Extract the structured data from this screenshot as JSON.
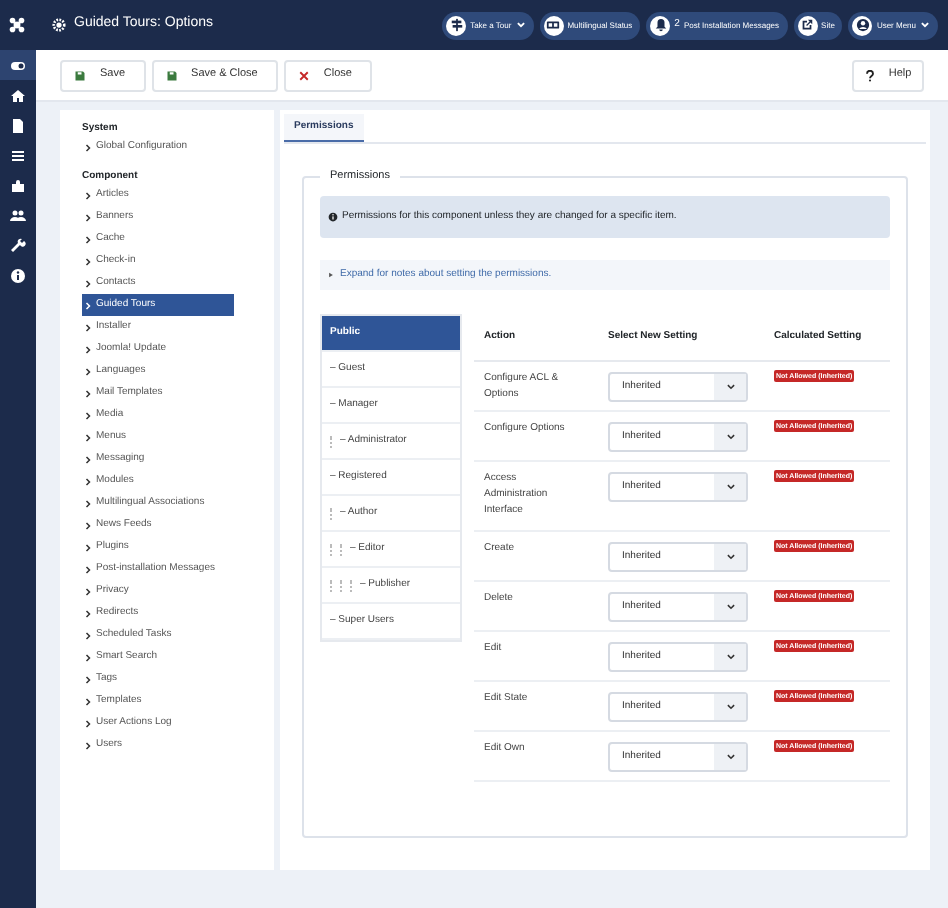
{
  "header": {
    "title": "Guided Tours: Options",
    "menus": [
      {
        "label": "Take a Tour",
        "kind": "dropdown"
      },
      {
        "label": "Multilingual Status",
        "kind": "plain"
      },
      {
        "label": "Post Installation Messages",
        "kind": "count",
        "count": "2"
      },
      {
        "label": "Site",
        "kind": "plain"
      },
      {
        "label": "User Menu",
        "kind": "dropdown"
      }
    ]
  },
  "sidebar": {
    "items": [
      {
        "selected": true
      },
      {
        "selected": false
      },
      {
        "selected": false
      },
      {
        "selected": false
      },
      {
        "selected": false
      },
      {
        "selected": false
      },
      {
        "selected": false
      },
      {
        "selected": false
      }
    ]
  },
  "toolbar": {
    "buttons": [
      {
        "label": "Save",
        "kind": "save"
      },
      {
        "label": "Save & Close",
        "kind": "save"
      },
      {
        "label": "Close",
        "kind": "close"
      }
    ],
    "help": "Help"
  },
  "components": {
    "sections": [
      {
        "title": "System",
        "items": [
          {
            "label": "Global Configuration",
            "selected": false
          }
        ]
      },
      {
        "title": "Component",
        "items": [
          {
            "label": "Articles",
            "selected": false
          },
          {
            "label": "Banners",
            "selected": false
          },
          {
            "label": "Cache",
            "selected": false
          },
          {
            "label": "Check-in",
            "selected": false
          },
          {
            "label": "Contacts",
            "selected": false
          },
          {
            "label": "Guided Tours",
            "selected": true
          },
          {
            "label": "Installer",
            "selected": false
          },
          {
            "label": "Joomla! Update",
            "selected": false
          },
          {
            "label": "Languages",
            "selected": false
          },
          {
            "label": "Mail Templates",
            "selected": false
          },
          {
            "label": "Media",
            "selected": false
          },
          {
            "label": "Menus",
            "selected": false
          },
          {
            "label": "Messaging",
            "selected": false
          },
          {
            "label": "Modules",
            "selected": false
          },
          {
            "label": "Multilingual Associations",
            "selected": false
          },
          {
            "label": "News Feeds",
            "selected": false
          },
          {
            "label": "Plugins",
            "selected": false
          },
          {
            "label": "Post-installation Messages",
            "selected": false
          },
          {
            "label": "Privacy",
            "selected": false
          },
          {
            "label": "Redirects",
            "selected": false
          },
          {
            "label": "Scheduled Tasks",
            "selected": false
          },
          {
            "label": "Smart Search",
            "selected": false
          },
          {
            "label": "Tags",
            "selected": false
          },
          {
            "label": "Templates",
            "selected": false
          },
          {
            "label": "User Actions Log",
            "selected": false
          },
          {
            "label": "Users",
            "selected": false
          }
        ]
      }
    ]
  },
  "tabs": [
    {
      "label": "Permissions",
      "selected": true
    }
  ],
  "permissions": {
    "legend": "Permissions",
    "info": "Permissions for this component unless they are changed for a specific item.",
    "expand": "Expand for notes about setting the permissions.",
    "groups": [
      {
        "label": "Public",
        "selected": true,
        "children": [
          {
            "label": "– Guest",
            "selected": false
          },
          {
            "label": "– Manager",
            "selected": false,
            "children": [
              {
                "label": "– Administrator",
                "selected": false
              }
            ]
          },
          {
            "label": "– Registered",
            "selected": false,
            "children": [
              {
                "label": "– Author",
                "selected": false,
                "children": [
                  {
                    "label": "– Editor",
                    "selected": false,
                    "children": [
                      {
                        "label": "– Publisher",
                        "selected": false
                      }
                    ]
                  }
                ]
              }
            ]
          },
          {
            "label": "– Super Users",
            "selected": false
          }
        ]
      }
    ],
    "columns": [
      "Action",
      "Select New Setting",
      "Calculated Setting"
    ],
    "rows": [
      {
        "action": "Configure ACL & Options",
        "setting": "Inherited",
        "calculated": "Not Allowed (Inherited)"
      },
      {
        "action": "Configure Options",
        "setting": "Inherited",
        "calculated": "Not Allowed (Inherited)"
      },
      {
        "action": "Access Administration Interface",
        "setting": "Inherited",
        "calculated": "Not Allowed (Inherited)"
      },
      {
        "action": "Create",
        "setting": "Inherited",
        "calculated": "Not Allowed (Inherited)"
      },
      {
        "action": "Delete",
        "setting": "Inherited",
        "calculated": "Not Allowed (Inherited)"
      },
      {
        "action": "Edit",
        "setting": "Inherited",
        "calculated": "Not Allowed (Inherited)"
      },
      {
        "action": "Edit State",
        "setting": "Inherited",
        "calculated": "Not Allowed (Inherited)"
      },
      {
        "action": "Edit Own",
        "setting": "Inherited",
        "calculated": "Not Allowed (Inherited)"
      }
    ]
  }
}
